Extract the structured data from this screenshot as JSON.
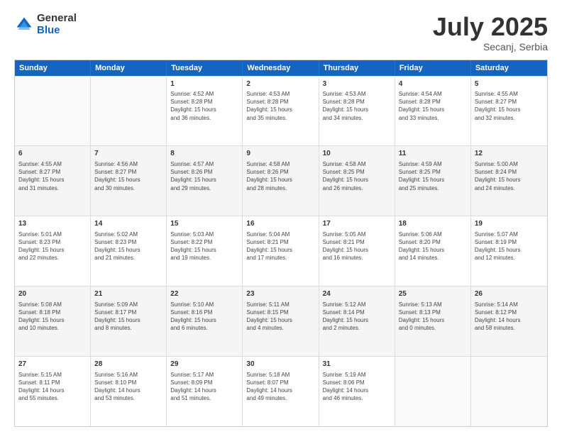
{
  "logo": {
    "general": "General",
    "blue": "Blue"
  },
  "header": {
    "month": "July 2025",
    "location": "Secanj, Serbia"
  },
  "days": [
    "Sunday",
    "Monday",
    "Tuesday",
    "Wednesday",
    "Thursday",
    "Friday",
    "Saturday"
  ],
  "weeks": [
    [
      {
        "day": "",
        "lines": []
      },
      {
        "day": "",
        "lines": []
      },
      {
        "day": "1",
        "lines": [
          "Sunrise: 4:52 AM",
          "Sunset: 8:28 PM",
          "Daylight: 15 hours",
          "and 36 minutes."
        ]
      },
      {
        "day": "2",
        "lines": [
          "Sunrise: 4:53 AM",
          "Sunset: 8:28 PM",
          "Daylight: 15 hours",
          "and 35 minutes."
        ]
      },
      {
        "day": "3",
        "lines": [
          "Sunrise: 4:53 AM",
          "Sunset: 8:28 PM",
          "Daylight: 15 hours",
          "and 34 minutes."
        ]
      },
      {
        "day": "4",
        "lines": [
          "Sunrise: 4:54 AM",
          "Sunset: 8:28 PM",
          "Daylight: 15 hours",
          "and 33 minutes."
        ]
      },
      {
        "day": "5",
        "lines": [
          "Sunrise: 4:55 AM",
          "Sunset: 8:27 PM",
          "Daylight: 15 hours",
          "and 32 minutes."
        ]
      }
    ],
    [
      {
        "day": "6",
        "lines": [
          "Sunrise: 4:55 AM",
          "Sunset: 8:27 PM",
          "Daylight: 15 hours",
          "and 31 minutes."
        ]
      },
      {
        "day": "7",
        "lines": [
          "Sunrise: 4:56 AM",
          "Sunset: 8:27 PM",
          "Daylight: 15 hours",
          "and 30 minutes."
        ]
      },
      {
        "day": "8",
        "lines": [
          "Sunrise: 4:57 AM",
          "Sunset: 8:26 PM",
          "Daylight: 15 hours",
          "and 29 minutes."
        ]
      },
      {
        "day": "9",
        "lines": [
          "Sunrise: 4:58 AM",
          "Sunset: 8:26 PM",
          "Daylight: 15 hours",
          "and 28 minutes."
        ]
      },
      {
        "day": "10",
        "lines": [
          "Sunrise: 4:58 AM",
          "Sunset: 8:25 PM",
          "Daylight: 15 hours",
          "and 26 minutes."
        ]
      },
      {
        "day": "11",
        "lines": [
          "Sunrise: 4:59 AM",
          "Sunset: 8:25 PM",
          "Daylight: 15 hours",
          "and 25 minutes."
        ]
      },
      {
        "day": "12",
        "lines": [
          "Sunrise: 5:00 AM",
          "Sunset: 8:24 PM",
          "Daylight: 15 hours",
          "and 24 minutes."
        ]
      }
    ],
    [
      {
        "day": "13",
        "lines": [
          "Sunrise: 5:01 AM",
          "Sunset: 8:23 PM",
          "Daylight: 15 hours",
          "and 22 minutes."
        ]
      },
      {
        "day": "14",
        "lines": [
          "Sunrise: 5:02 AM",
          "Sunset: 8:23 PM",
          "Daylight: 15 hours",
          "and 21 minutes."
        ]
      },
      {
        "day": "15",
        "lines": [
          "Sunrise: 5:03 AM",
          "Sunset: 8:22 PM",
          "Daylight: 15 hours",
          "and 19 minutes."
        ]
      },
      {
        "day": "16",
        "lines": [
          "Sunrise: 5:04 AM",
          "Sunset: 8:21 PM",
          "Daylight: 15 hours",
          "and 17 minutes."
        ]
      },
      {
        "day": "17",
        "lines": [
          "Sunrise: 5:05 AM",
          "Sunset: 8:21 PM",
          "Daylight: 15 hours",
          "and 16 minutes."
        ]
      },
      {
        "day": "18",
        "lines": [
          "Sunrise: 5:06 AM",
          "Sunset: 8:20 PM",
          "Daylight: 15 hours",
          "and 14 minutes."
        ]
      },
      {
        "day": "19",
        "lines": [
          "Sunrise: 5:07 AM",
          "Sunset: 8:19 PM",
          "Daylight: 15 hours",
          "and 12 minutes."
        ]
      }
    ],
    [
      {
        "day": "20",
        "lines": [
          "Sunrise: 5:08 AM",
          "Sunset: 8:18 PM",
          "Daylight: 15 hours",
          "and 10 minutes."
        ]
      },
      {
        "day": "21",
        "lines": [
          "Sunrise: 5:09 AM",
          "Sunset: 8:17 PM",
          "Daylight: 15 hours",
          "and 8 minutes."
        ]
      },
      {
        "day": "22",
        "lines": [
          "Sunrise: 5:10 AM",
          "Sunset: 8:16 PM",
          "Daylight: 15 hours",
          "and 6 minutes."
        ]
      },
      {
        "day": "23",
        "lines": [
          "Sunrise: 5:11 AM",
          "Sunset: 8:15 PM",
          "Daylight: 15 hours",
          "and 4 minutes."
        ]
      },
      {
        "day": "24",
        "lines": [
          "Sunrise: 5:12 AM",
          "Sunset: 8:14 PM",
          "Daylight: 15 hours",
          "and 2 minutes."
        ]
      },
      {
        "day": "25",
        "lines": [
          "Sunrise: 5:13 AM",
          "Sunset: 8:13 PM",
          "Daylight: 15 hours",
          "and 0 minutes."
        ]
      },
      {
        "day": "26",
        "lines": [
          "Sunrise: 5:14 AM",
          "Sunset: 8:12 PM",
          "Daylight: 14 hours",
          "and 58 minutes."
        ]
      }
    ],
    [
      {
        "day": "27",
        "lines": [
          "Sunrise: 5:15 AM",
          "Sunset: 8:11 PM",
          "Daylight: 14 hours",
          "and 55 minutes."
        ]
      },
      {
        "day": "28",
        "lines": [
          "Sunrise: 5:16 AM",
          "Sunset: 8:10 PM",
          "Daylight: 14 hours",
          "and 53 minutes."
        ]
      },
      {
        "day": "29",
        "lines": [
          "Sunrise: 5:17 AM",
          "Sunset: 8:09 PM",
          "Daylight: 14 hours",
          "and 51 minutes."
        ]
      },
      {
        "day": "30",
        "lines": [
          "Sunrise: 5:18 AM",
          "Sunset: 8:07 PM",
          "Daylight: 14 hours",
          "and 49 minutes."
        ]
      },
      {
        "day": "31",
        "lines": [
          "Sunrise: 5:19 AM",
          "Sunset: 8:06 PM",
          "Daylight: 14 hours",
          "and 46 minutes."
        ]
      },
      {
        "day": "",
        "lines": []
      },
      {
        "day": "",
        "lines": []
      }
    ]
  ]
}
